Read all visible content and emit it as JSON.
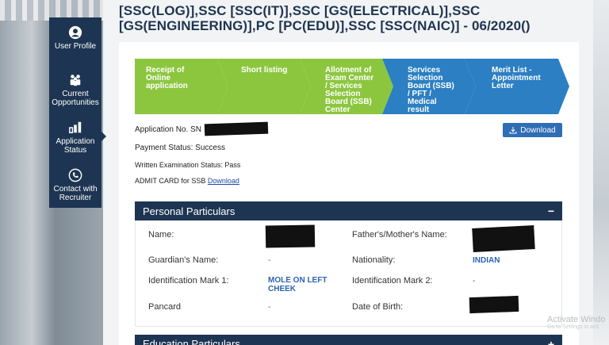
{
  "sidebar": {
    "items": [
      {
        "label": "User Profile",
        "icon": "user-icon"
      },
      {
        "label": "Current Opportunities",
        "icon": "people-icon"
      },
      {
        "label": "Application Status",
        "icon": "chart-icon"
      },
      {
        "label": "Contact with Recruiter",
        "icon": "phone-icon"
      }
    ],
    "active": "Application Status"
  },
  "heading": {
    "line1": "[SSC(LOG)],SSC [SSC(IT)],SSC [GS(ELECTRICAL)],SSC",
    "line2": "[GS(ENGINEERING)],PC [PC(EDU)],SSC [SSC(NAIC)] - 06/2020()"
  },
  "steps": [
    {
      "label": "Receipt of Online application",
      "color": "#8cc63f"
    },
    {
      "label": "Short listing",
      "color": "#8cc63f"
    },
    {
      "label": "Allotment of Exam Center / Services Selection Board (SSB) Center",
      "color": "#8cc63f"
    },
    {
      "label": "Services Selection Board (SSB) / PFT / Medical result",
      "color": "#2b7fc2"
    },
    {
      "label": "Merit List - Appointment Letter",
      "color": "#2b7fc2"
    }
  ],
  "application": {
    "number_label": "Application No. SN",
    "download_label": "Download",
    "payment_status": "Payment Status: Success",
    "written_label": "Written Examination Status:",
    "written_value": "Pass",
    "admit_label": "ADMIT CARD for SSB",
    "admit_link": "Download"
  },
  "personal": {
    "title": "Personal Particulars",
    "toggle": "−",
    "fields": {
      "name_label": "Name:",
      "parent_label": "Father's/Mother's Name:",
      "guardian_label": "Guardian's Name:",
      "guardian_value": "-",
      "nationality_label": "Nationality:",
      "nationality_value": "INDIAN",
      "mark1_label": "Identification Mark 1:",
      "mark1_value": "MOLE ON LEFT CHEEK",
      "mark2_label": "Identification Mark 2:",
      "mark2_value": "-",
      "pancard_label": "Pancard",
      "pancard_value": "-",
      "dob_label": "Date of Birth:"
    }
  },
  "education": {
    "title": "Education Particulars",
    "toggle": "+"
  },
  "watermark": {
    "line1": "Activate Windo",
    "line2": "Go to Settings to acti"
  }
}
